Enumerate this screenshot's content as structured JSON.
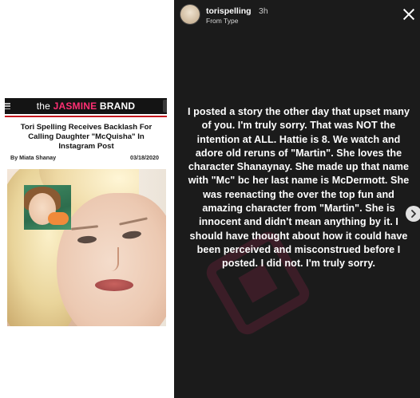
{
  "article": {
    "brand": {
      "prefix": "the",
      "name_pink": "JASMINE",
      "name_white": "BRAND"
    },
    "headline": "Tori Spelling Receives Backlash For Calling Daughter \"McQuisha\" In Instagram Post",
    "byline": "By Miata Shanay",
    "date": "03/18/2020"
  },
  "story": {
    "username": "torispelling",
    "time": "3h",
    "subtitle": "From Type",
    "body": "I posted a story the other day that upset many of you. I'm truly sorry. That was NOT the intention at ALL. Hattie is 8. We watch and adore old reruns of \"Martin\". She loves the character Shanaynay. She made up that name with \"Mc\" bc her last name is McDermott. She was reenacting the over the top fun and amazing character from \"Martin\". She is innocent and didn't mean anything by it. I should have thought about how it could have been perceived and misconstrued before I posted. I did not. I'm truly sorry."
  },
  "colors": {
    "brand_pink": "#ff2f73",
    "brand_red_rule": "#c4171e",
    "story_bg": "#1b1b1b"
  },
  "icons": [
    "hamburger-icon",
    "close-icon",
    "chevron-right-icon",
    "watermark-logo"
  ]
}
